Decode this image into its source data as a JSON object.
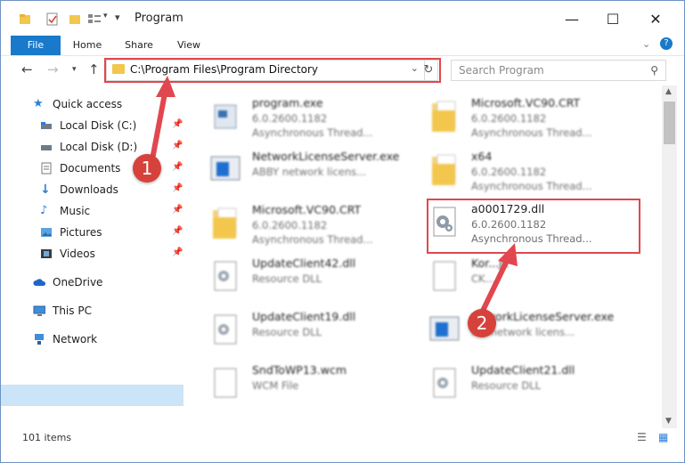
{
  "window": {
    "title": "Program"
  },
  "ribbon": {
    "tabs": [
      "File",
      "Home",
      "Share",
      "View"
    ]
  },
  "address": {
    "path": "C:\\Program Files\\Program Directory"
  },
  "search": {
    "placeholder": "Search Program"
  },
  "sidebar": {
    "items": [
      {
        "label": "Quick access",
        "icon": "star-icon"
      },
      {
        "label": "Local Disk (C:)",
        "icon": "drive-icon"
      },
      {
        "label": "Local Disk (D:)",
        "icon": "drive-icon"
      },
      {
        "label": "Documents",
        "icon": "documents-icon"
      },
      {
        "label": "Downloads",
        "icon": "downloads-icon"
      },
      {
        "label": "Music",
        "icon": "music-icon"
      },
      {
        "label": "Pictures",
        "icon": "pictures-icon"
      },
      {
        "label": "Videos",
        "icon": "videos-icon"
      },
      {
        "label": "OneDrive",
        "icon": "cloud-icon"
      },
      {
        "label": "This PC",
        "icon": "pc-icon"
      },
      {
        "label": "Network",
        "icon": "network-icon"
      }
    ]
  },
  "files": [
    {
      "name": "program.exe",
      "line1": "6.0.2600.1182",
      "line2": "Asynchronous Thread...",
      "icon": "exe-icon"
    },
    {
      "name": "Microsoft.VC90.CRT",
      "line1": "6.0.2600.1182",
      "line2": "Asynchronous Thread...",
      "icon": "folder-icon"
    },
    {
      "name": "NetworkLicenseServer.exe",
      "line1": "ABBY network licens...",
      "line2": "",
      "icon": "app-window-icon"
    },
    {
      "name": "x64",
      "line1": "6.0.2600.1182",
      "line2": "Asynchronous Thread...",
      "icon": "folder-icon"
    },
    {
      "name": "Microsoft.VC90.CRT",
      "line1": "6.0.2600.1182",
      "line2": "Asynchronous Thread...",
      "icon": "folder-icon"
    },
    {
      "name": "a0001729.dll",
      "line1": "6.0.2600.1182",
      "line2": "Asynchronous Thread...",
      "icon": "dll-gear-icon"
    },
    {
      "name": "UpdateClient42.dll",
      "line1": "Resource DLL",
      "line2": "",
      "icon": "dll-gear-icon"
    },
    {
      "name": "Kor...jk",
      "line1": "CK...",
      "line2": "",
      "icon": "file-icon"
    },
    {
      "name": "UpdateClient19.dll",
      "line1": "Resource DLL",
      "line2": "",
      "icon": "dll-gear-icon"
    },
    {
      "name": "...tworkLicenseServer.exe",
      "line1": "...Y network licens...",
      "line2": "",
      "icon": "app-window-icon"
    },
    {
      "name": "SndToWP13.wcm",
      "line1": "WCM File",
      "line2": "",
      "icon": "file-icon"
    },
    {
      "name": "UpdateClient21.dll",
      "line1": "Resource DLL",
      "line2": "",
      "icon": "dll-gear-icon"
    }
  ],
  "status": {
    "count": "101 items"
  },
  "annotations": {
    "badge1": "1",
    "badge2": "2"
  },
  "colors": {
    "accent": "#1979ca",
    "highlight": "#e1474e",
    "selected": "#cce4f7"
  }
}
